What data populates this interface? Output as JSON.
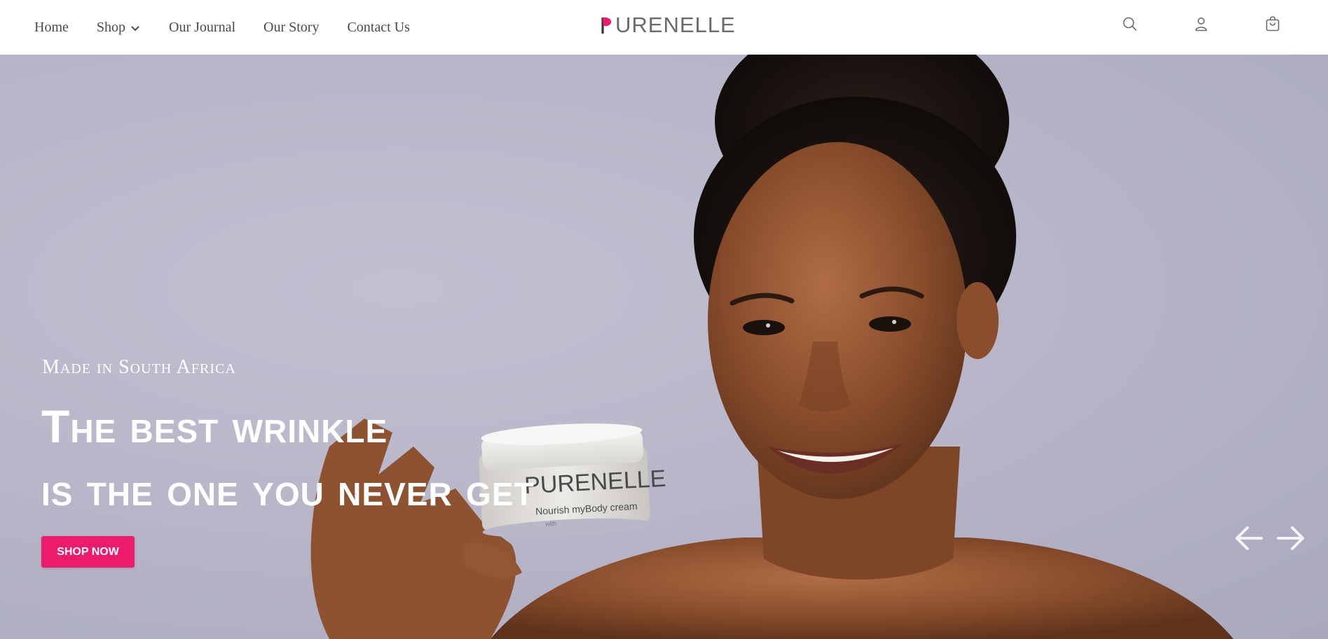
{
  "nav": {
    "items": [
      {
        "label": "Home"
      },
      {
        "label": "Shop",
        "has_dropdown": true
      },
      {
        "label": "Our Journal"
      },
      {
        "label": "Our Story"
      },
      {
        "label": "Contact Us"
      }
    ]
  },
  "logo": {
    "text": "URENELLE",
    "letter": "P",
    "brand_color": "#ed1b6d",
    "text_color": "#6a6a6a"
  },
  "header_icons": [
    "search-icon",
    "account-icon",
    "cart-icon"
  ],
  "hero": {
    "subtitle": "Made in South Africa",
    "headline_line1": "The best wrinkle",
    "headline_line2": "is the one you never get",
    "cta_label": "SHOP NOW",
    "cta_color": "#ed1b6d",
    "background_color": "#b8b7c9",
    "jar_brand": "PURENELLE",
    "jar_product": "Nourish myBody cream",
    "jar_with": "with",
    "prev_icon": "arrow-left-icon",
    "next_icon": "arrow-right-icon"
  }
}
